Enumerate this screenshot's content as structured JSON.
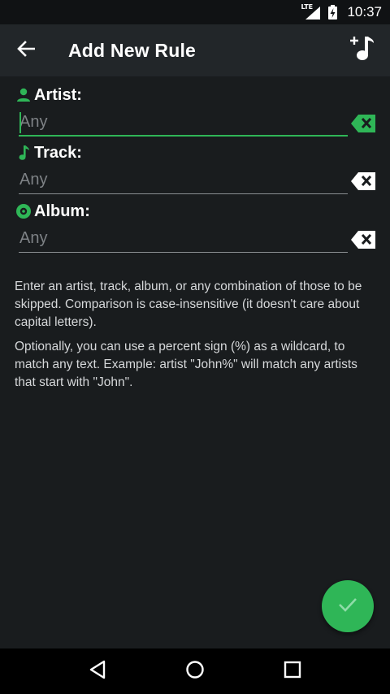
{
  "status_bar": {
    "network": "LTE",
    "time": "10:37",
    "icons": [
      "signal-icon",
      "battery-icon"
    ]
  },
  "toolbar": {
    "title": "Add New Rule",
    "back_icon": "arrow-back-icon",
    "action_icon": "add-music-icon"
  },
  "form": {
    "artist": {
      "label": "Artist:",
      "placeholder": "Any",
      "value": "",
      "icon": "person-icon",
      "focused": true
    },
    "track": {
      "label": "Track:",
      "placeholder": "Any",
      "value": "",
      "icon": "music-note-icon"
    },
    "album": {
      "label": "Album:",
      "placeholder": "Any",
      "value": "",
      "icon": "album-icon"
    }
  },
  "help": {
    "paragraph1": "Enter an artist, track, album, or any combination of those to be skipped. Comparison is case-insensitive (it doesn't care about capital letters).",
    "paragraph2": "Optionally, you can use a percent sign (%) as a wildcard, to match any text. Example: artist \"John%\" will match any artists that start with \"John\"."
  },
  "fab": {
    "icon": "check-icon"
  },
  "navigation": {
    "icons": [
      "back-triangle-icon",
      "home-circle-icon",
      "recents-square-icon"
    ]
  },
  "colors": {
    "accent": "#2fb657",
    "background": "#191c1e",
    "toolbar": "#222629",
    "status_bar": "#101214"
  }
}
